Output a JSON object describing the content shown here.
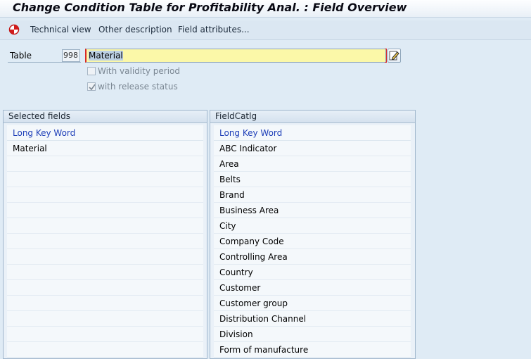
{
  "title": "Change Condition Table for Profitability Anal. : Field Overview",
  "toolbar": {
    "technical_view": "Technical view",
    "other_description": "Other description",
    "field_attributes": "Field attributes..."
  },
  "form": {
    "table_label": "Table",
    "table_number": "998",
    "table_value": "Material",
    "validity_period_label": "With validity period",
    "validity_period_checked": false,
    "release_status_label": "with release status",
    "release_status_checked": true
  },
  "selected_fields": {
    "title": "Selected fields",
    "column": "Long Key Word",
    "rows": [
      "Material",
      "",
      "",
      "",
      "",
      "",
      "",
      "",
      "",
      "",
      "",
      "",
      "",
      ""
    ]
  },
  "field_catalog": {
    "title": "FieldCatlg",
    "column": "Long Key Word",
    "rows": [
      "ABC Indicator",
      "Area",
      "Belts",
      "Brand",
      "Business Area",
      "City",
      "Company Code",
      "Controlling Area",
      "Country",
      "Customer",
      "Customer group",
      "Distribution Channel",
      "Division",
      "Form of manufacture"
    ]
  },
  "colors": {
    "accent_blue": "#1e3fb8",
    "input_yellow": "#fbf8a8",
    "required_red": "#d62a2a"
  },
  "icons": [
    "exit-icon",
    "edit-pencil-icon",
    "checkbox-checked-icon"
  ]
}
